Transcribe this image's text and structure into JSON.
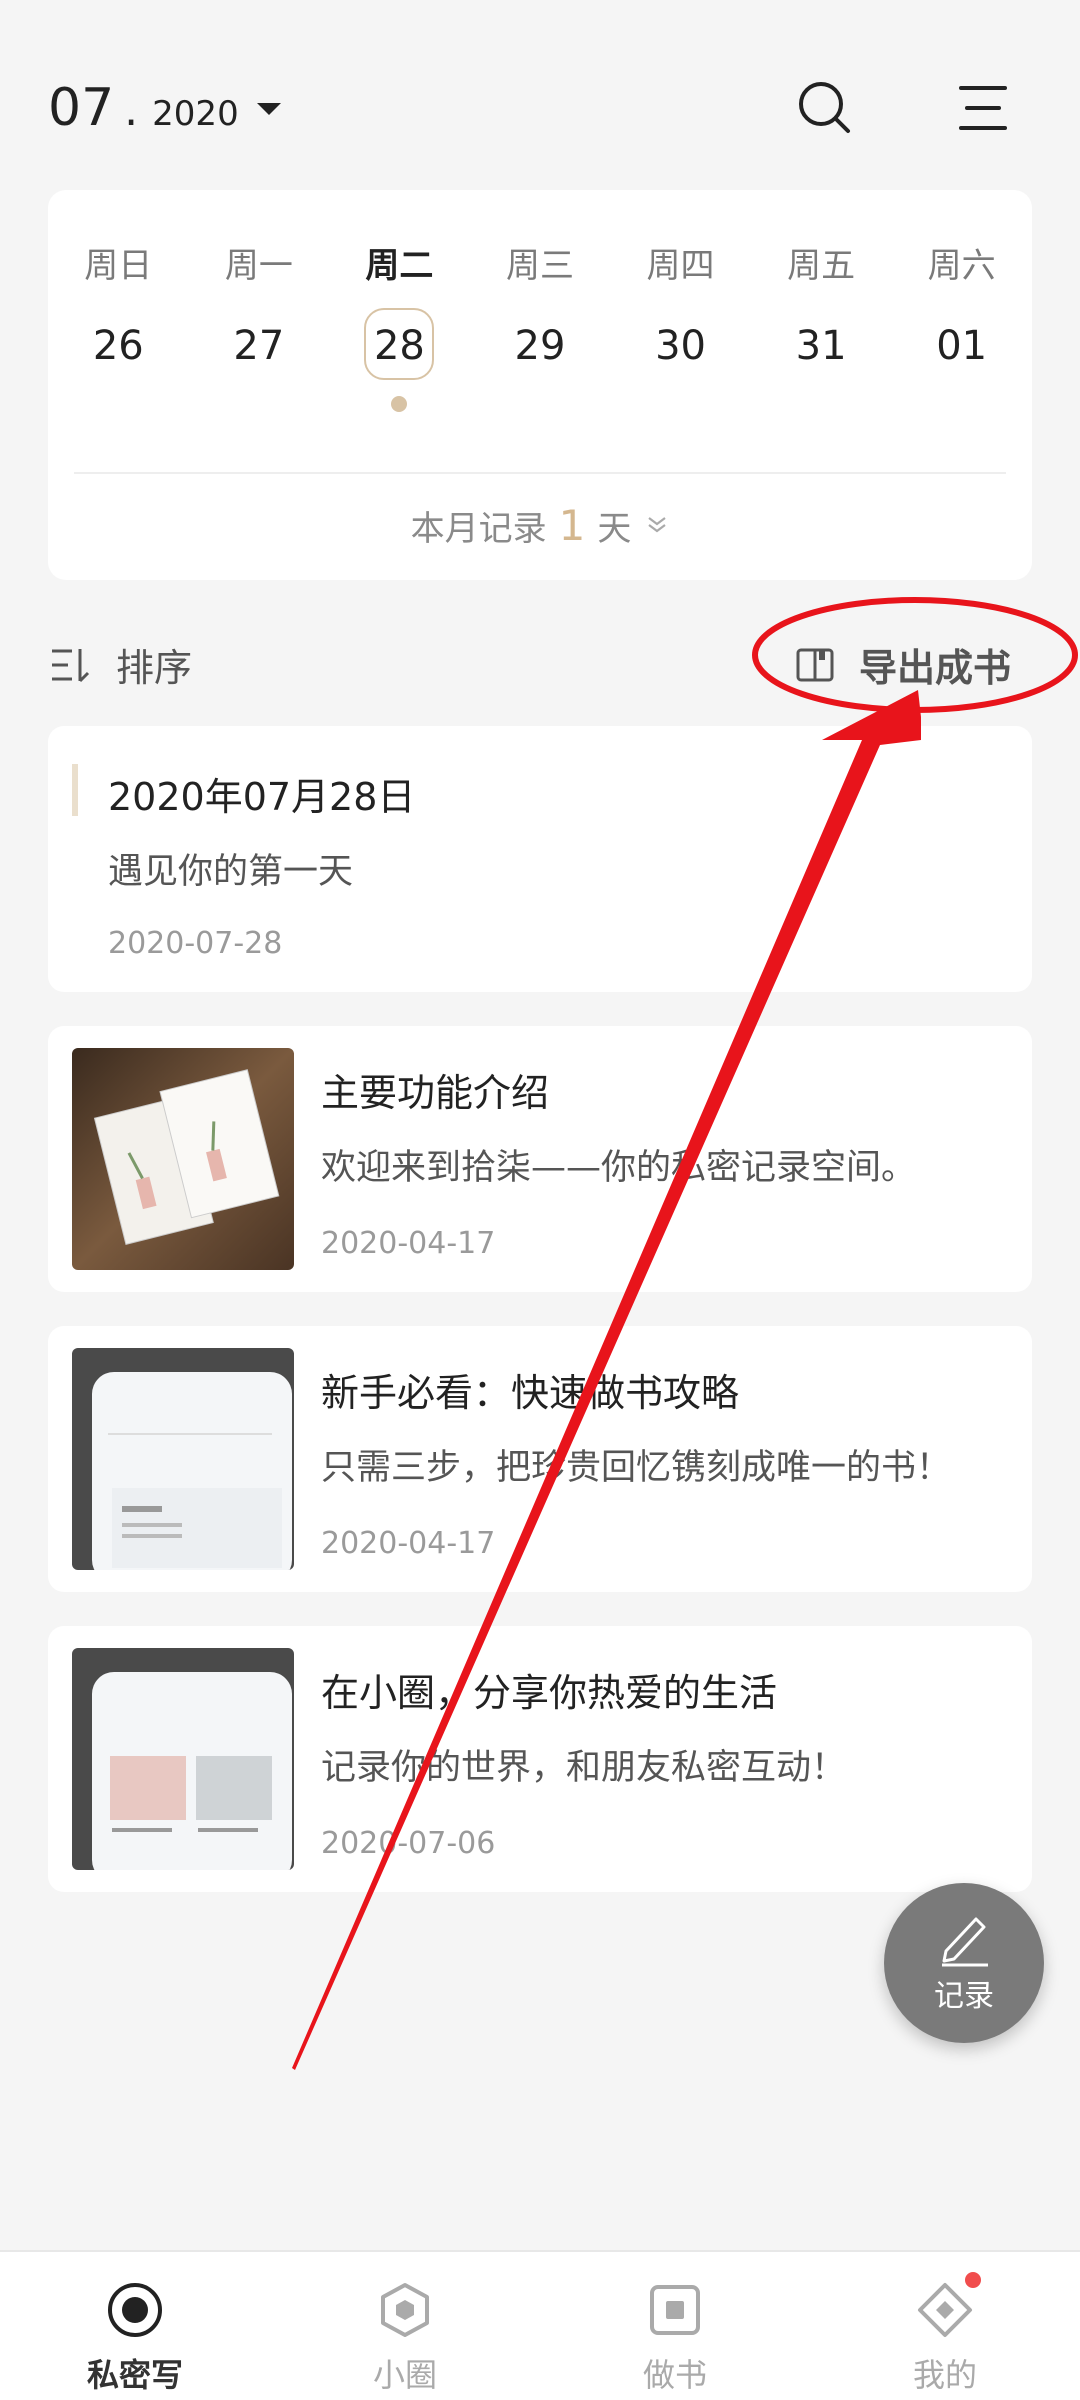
{
  "header": {
    "month": "07",
    "separator": ".",
    "year": "2020"
  },
  "calendar": {
    "weekdays": [
      "周日",
      "周一",
      "周二",
      "周三",
      "周四",
      "周五",
      "周六"
    ],
    "dates": [
      "26",
      "27",
      "28",
      "29",
      "30",
      "31",
      "01"
    ],
    "selected_index": 2,
    "summary_prefix": "本月记录",
    "summary_count": "1",
    "summary_suffix": "天"
  },
  "toolbar": {
    "sort_label": "排序",
    "export_label": "导出成书"
  },
  "entries": [
    {
      "title": "2020年07月28日",
      "excerpt": "遇见你的第一天",
      "date": "2020-07-28"
    },
    {
      "title": "主要功能介绍",
      "excerpt": "欢迎来到拾柒——你的私密记录空间。",
      "date": "2020-04-17",
      "thumb": "book-photo"
    },
    {
      "title": "新手必看：快速做书攻略",
      "excerpt": "只需三步，把珍贵回忆镌刻成唯一的书！",
      "date": "2020-04-17",
      "thumb": "phone-screenshot"
    },
    {
      "title": "在小圈，分享你热爱的生活",
      "excerpt": "记录你的世界，和朋友私密互动！",
      "date": "2020-07-06",
      "thumb": "phone-screenshot"
    }
  ],
  "fab": {
    "label": "记录"
  },
  "nav": {
    "items": [
      {
        "label": "私密写",
        "icon": "record-circle-icon",
        "active": true
      },
      {
        "label": "小圈",
        "icon": "hexagon-icon",
        "active": false
      },
      {
        "label": "做书",
        "icon": "book-square-icon",
        "active": false
      },
      {
        "label": "我的",
        "icon": "diamond-icon",
        "active": false,
        "badge": true
      }
    ]
  },
  "colors": {
    "accent": "#d4b78f",
    "annotation_red": "#e8141b",
    "fab": "#7a7a7a",
    "badge": "#f14d4d"
  }
}
